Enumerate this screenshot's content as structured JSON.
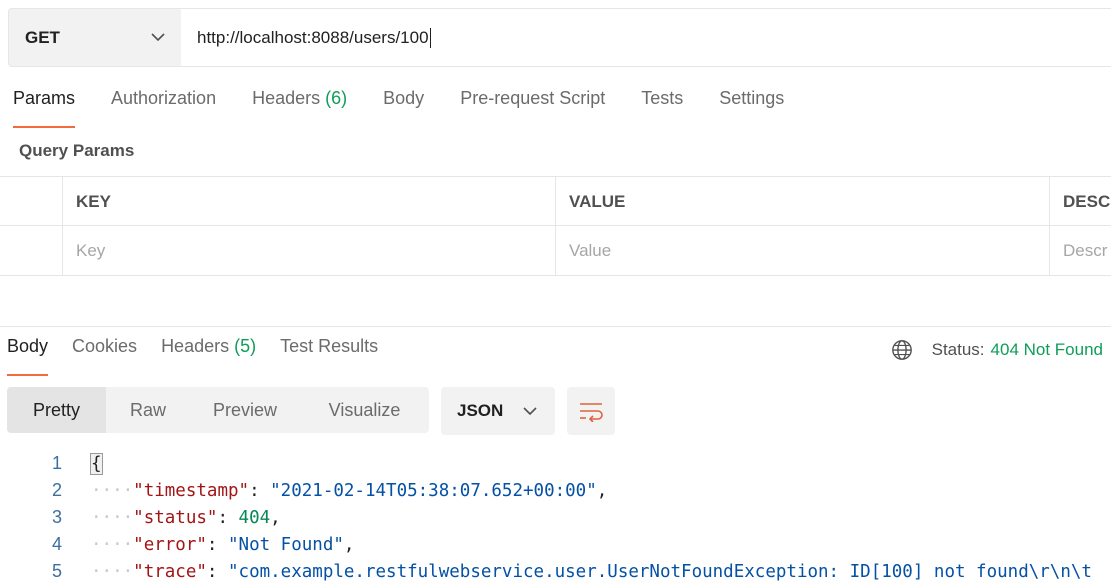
{
  "request": {
    "method": "GET",
    "url": "http://localhost:8088/users/100"
  },
  "request_tabs": [
    {
      "label": "Params",
      "count": ""
    },
    {
      "label": "Authorization",
      "count": ""
    },
    {
      "label": "Headers",
      "count": "(6)"
    },
    {
      "label": "Body",
      "count": ""
    },
    {
      "label": "Pre-request Script",
      "count": ""
    },
    {
      "label": "Tests",
      "count": ""
    },
    {
      "label": "Settings",
      "count": ""
    }
  ],
  "query_params": {
    "title": "Query Params",
    "columns": [
      "KEY",
      "VALUE",
      "DESC"
    ],
    "placeholders": [
      "Key",
      "Value",
      "Descr"
    ]
  },
  "response_tabs": [
    {
      "label": "Body",
      "count": ""
    },
    {
      "label": "Cookies",
      "count": ""
    },
    {
      "label": "Headers",
      "count": "(5)"
    },
    {
      "label": "Test Results",
      "count": ""
    }
  ],
  "status": {
    "label": "Status:",
    "code": "404 Not Found"
  },
  "view_modes": [
    "Pretty",
    "Raw",
    "Preview",
    "Visualize"
  ],
  "format": "JSON",
  "code_lines": [
    {
      "num": "1",
      "indent": "",
      "key": "",
      "sep": "",
      "value": "{",
      "kind": "brace",
      "tail": ""
    },
    {
      "num": "2",
      "indent": "····",
      "key": "\"timestamp\"",
      "sep": ": ",
      "value": "\"2021-02-14T05:38:07.652+00:00\"",
      "kind": "s",
      "tail": ","
    },
    {
      "num": "3",
      "indent": "····",
      "key": "\"status\"",
      "sep": ": ",
      "value": "404",
      "kind": "n",
      "tail": ","
    },
    {
      "num": "4",
      "indent": "····",
      "key": "\"error\"",
      "sep": ": ",
      "value": "\"Not Found\"",
      "kind": "s",
      "tail": ","
    },
    {
      "num": "5",
      "indent": "····",
      "key": "\"trace\"",
      "sep": ": ",
      "value": "\"com.example.restfulwebservice.user.UserNotFoundException: ID[100] not found\\r\\n\\t",
      "kind": "s",
      "tail": ""
    }
  ],
  "colors": {
    "accent": "#f26b3a",
    "success": "#0f9d58",
    "json_key": "#a31515",
    "json_string": "#0451a5",
    "json_number": "#098658"
  },
  "icons": [
    "chevron-down-icon",
    "globe-icon",
    "wrap-lines-icon"
  ]
}
